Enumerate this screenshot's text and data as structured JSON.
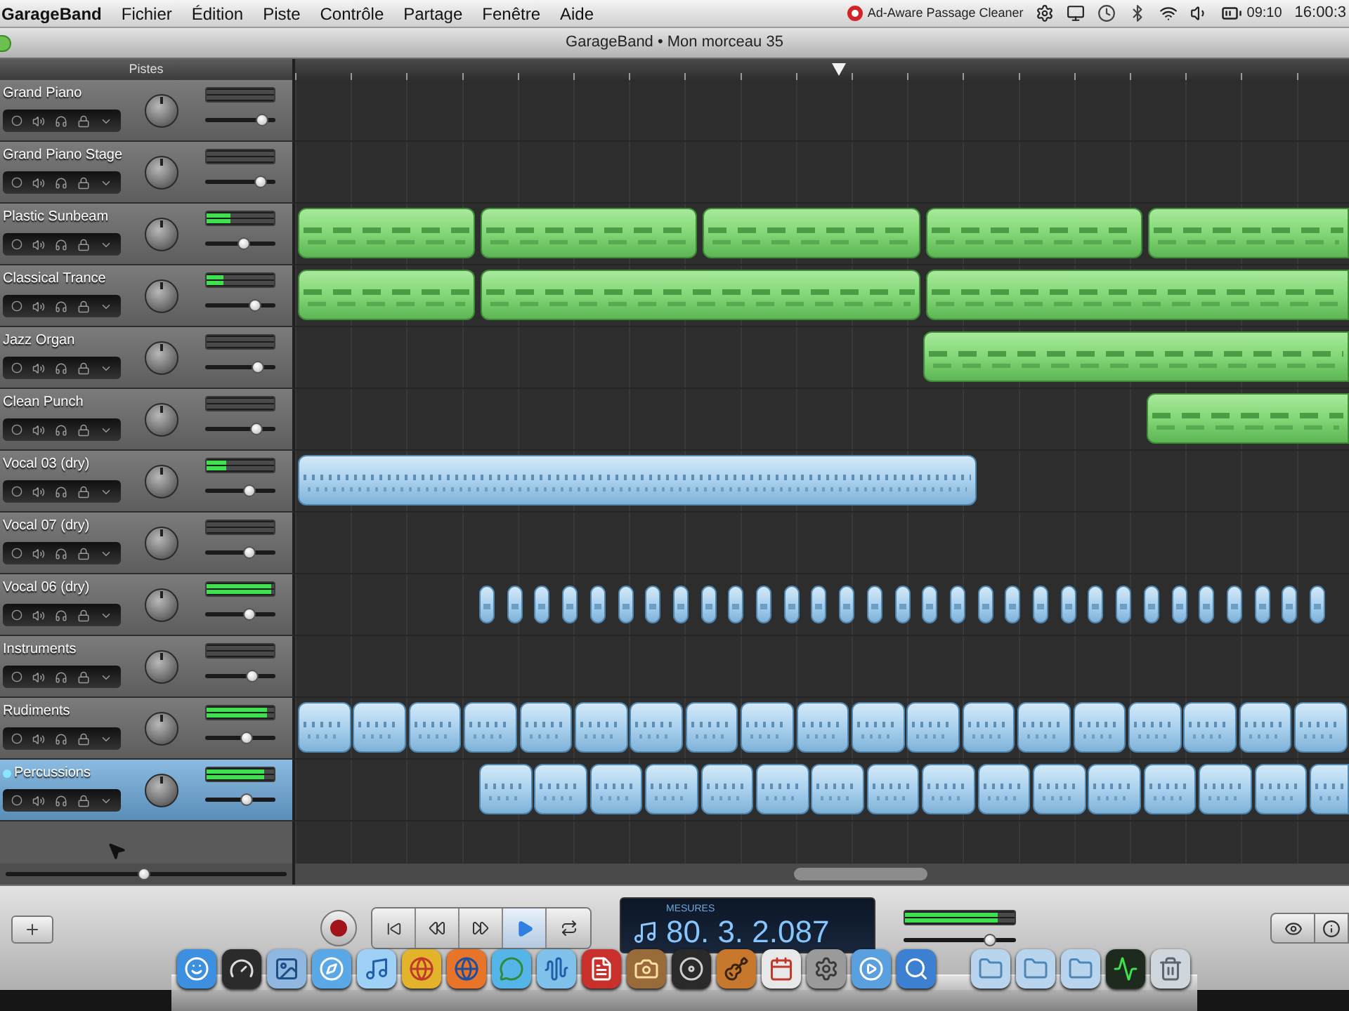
{
  "menu_bar": {
    "app_name": "GarageBand",
    "menus": [
      "Fichier",
      "Édition",
      "Piste",
      "Contrôle",
      "Partage",
      "Fenêtre",
      "Aide"
    ],
    "status_text": "Ad-Aware Passage Cleaner",
    "battery_time": "09:10",
    "clock": "16:00:3"
  },
  "window": {
    "title": "GarageBand • Mon morceau 35"
  },
  "track_list": {
    "header": "Pistes",
    "zoom_slider": {
      "level": 0.49
    }
  },
  "tracks": [
    {
      "name": "Grand Piano",
      "selected": false,
      "volume": {
        "level": 0.88
      }
    },
    {
      "name": "Grand Piano Stage",
      "selected": false,
      "volume": {
        "level": 0.85
      }
    },
    {
      "name": "Plastic Sunbeam",
      "kind": "software",
      "selected": false,
      "meter": {
        "level": 0.35
      },
      "volume": {
        "level": 0.55
      }
    },
    {
      "name": "Classical Trance",
      "kind": "software",
      "selected": false,
      "meter": {
        "level": 0.25
      },
      "volume": {
        "level": 0.75
      }
    },
    {
      "name": "Jazz Organ",
      "kind": "software",
      "selected": false,
      "volume": {
        "level": 0.8
      }
    },
    {
      "name": "Clean Punch",
      "kind": "software",
      "selected": false,
      "volume": {
        "level": 0.78
      }
    },
    {
      "name": "Vocal 03 (dry)",
      "kind": "audio",
      "selected": false,
      "meter": {
        "level": 0.3
      },
      "volume": {
        "level": 0.65
      }
    },
    {
      "name": "Vocal 07 (dry)",
      "selected": false,
      "volume": {
        "level": 0.65
      }
    },
    {
      "name": "Vocal 06 (dry)",
      "kind": "audio",
      "selected": false,
      "meter": {
        "level": 0.95
      },
      "volume": {
        "level": 0.65
      }
    },
    {
      "name": "Instruments",
      "selected": false,
      "volume": {
        "level": 0.7
      }
    },
    {
      "name": "Rudiments",
      "kind": "audio",
      "selected": false,
      "meter": {
        "level": 0.9
      },
      "volume": {
        "level": 0.62
      }
    },
    {
      "name": "Percussions",
      "kind": "audio",
      "selected": true,
      "meter": {
        "level": 0.85
      },
      "volume": {
        "level": 0.62
      }
    }
  ],
  "transport": {
    "playing": true,
    "display_label": "MESURES",
    "display_value": "80. 3. 2.087"
  },
  "master": {
    "meter": {
      "level": 0.85
    },
    "volume": {
      "level": 0.8
    }
  }
}
